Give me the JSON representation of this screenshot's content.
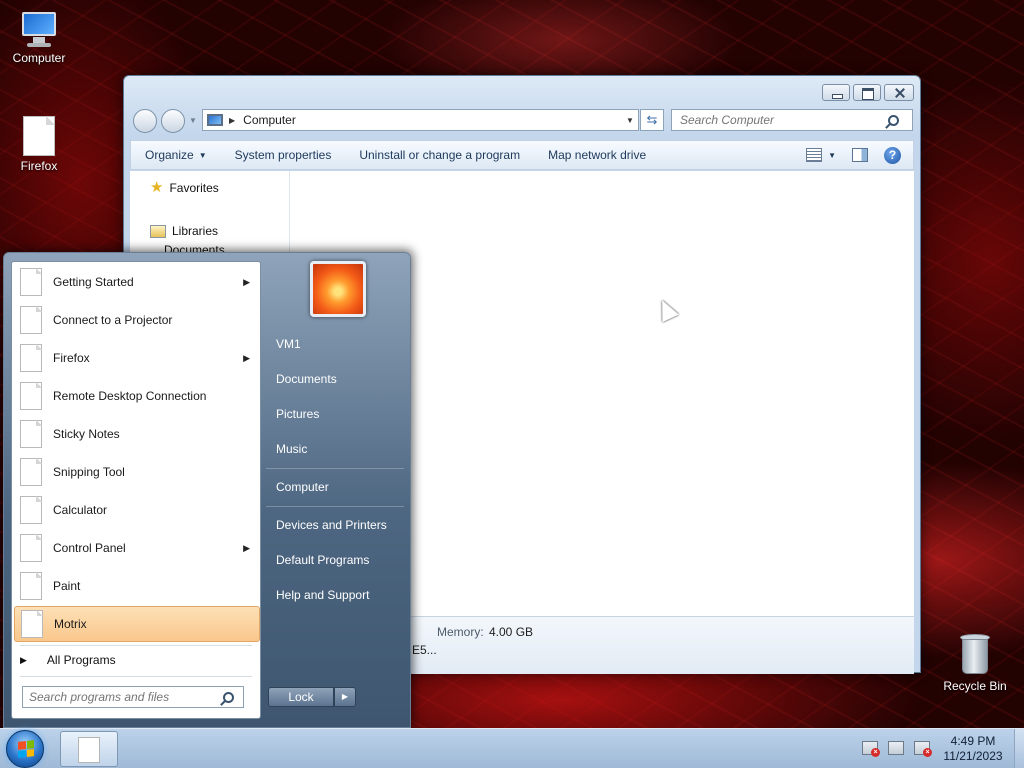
{
  "desktop": {
    "icons": [
      {
        "label": "Computer",
        "icon": "computer-icon"
      },
      {
        "label": "Firefox",
        "icon": "document-icon"
      },
      {
        "label": "Recycle Bin",
        "icon": "recycle-bin-icon"
      }
    ]
  },
  "explorer": {
    "address": "Computer",
    "search_placeholder": "Search Computer",
    "toolbar": {
      "organize": "Organize",
      "system_properties": "System properties",
      "uninstall": "Uninstall or change a program",
      "map_drive": "Map network drive"
    },
    "nav": {
      "favorites": "Favorites",
      "libraries": "Libraries",
      "documents": "Documents"
    },
    "details": {
      "memory_label": "Memory:",
      "memory_value": "4.00 GB",
      "processor_fragment": "E5..."
    }
  },
  "start_menu": {
    "programs": [
      {
        "label": "Getting Started",
        "has_submenu": true
      },
      {
        "label": "Connect to a Projector",
        "has_submenu": false
      },
      {
        "label": "Firefox",
        "has_submenu": true
      },
      {
        "label": "Remote Desktop Connection",
        "has_submenu": false
      },
      {
        "label": "Sticky Notes",
        "has_submenu": false
      },
      {
        "label": "Snipping Tool",
        "has_submenu": false
      },
      {
        "label": "Calculator",
        "has_submenu": false
      },
      {
        "label": "Control Panel",
        "has_submenu": true
      },
      {
        "label": "Paint",
        "has_submenu": false
      },
      {
        "label": "Motrix",
        "has_submenu": false,
        "highlighted": true
      }
    ],
    "all_programs": "All Programs",
    "search_placeholder": "Search programs and files",
    "places": {
      "user": "VM1",
      "documents": "Documents",
      "pictures": "Pictures",
      "music": "Music",
      "computer": "Computer",
      "devices": "Devices and Printers",
      "default_programs": "Default Programs",
      "help": "Help and Support"
    },
    "lock": "Lock"
  },
  "taskbar": {
    "time": "4:49 PM",
    "date": "11/21/2023"
  },
  "colors": {
    "highlight": "#f9c78c",
    "accent": "#2b74c9"
  }
}
